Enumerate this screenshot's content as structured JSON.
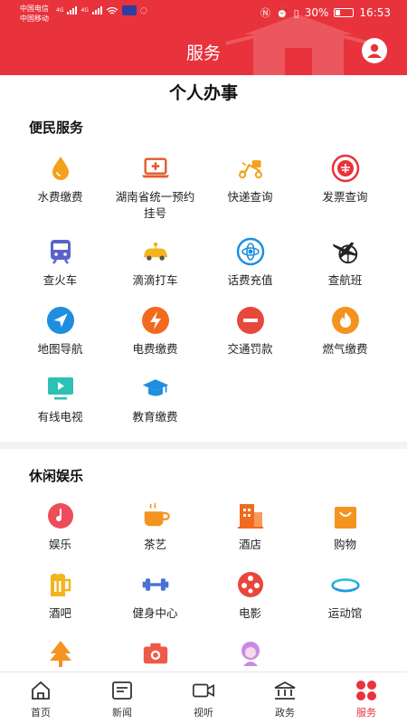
{
  "status_bar": {
    "carrier_1": "中国电信",
    "carrier_2": "中国移动",
    "net_1": "4G",
    "net_2": "4G",
    "battery": "30%",
    "time": "16:53"
  },
  "header": {
    "title": "服务"
  },
  "page_title": "个人办事",
  "sections": {
    "convenience": {
      "title": "便民服务",
      "items": [
        {
          "label": "水费缴费",
          "icon": "water-drop-icon"
        },
        {
          "label": "湖南省统一预约挂号",
          "icon": "medical-laptop-icon"
        },
        {
          "label": "快递查询",
          "icon": "delivery-scooter-icon"
        },
        {
          "label": "发票查询",
          "icon": "invoice-emblem-icon"
        },
        {
          "label": "查火车",
          "icon": "train-icon"
        },
        {
          "label": "滴滴打车",
          "icon": "taxi-icon"
        },
        {
          "label": "话费充值",
          "icon": "phone-recharge-icon"
        },
        {
          "label": "查航班",
          "icon": "airplane-icon"
        },
        {
          "label": "地图导航",
          "icon": "navigation-arrow-icon"
        },
        {
          "label": "电费缴费",
          "icon": "lightning-icon"
        },
        {
          "label": "交通罚款",
          "icon": "no-entry-icon"
        },
        {
          "label": "燃气缴费",
          "icon": "flame-icon"
        },
        {
          "label": "有线电视",
          "icon": "tv-play-icon"
        },
        {
          "label": "教育缴费",
          "icon": "graduation-cap-icon"
        }
      ]
    },
    "leisure": {
      "title": "休闲娱乐",
      "items": [
        {
          "label": "娱乐",
          "icon": "music-disc-icon"
        },
        {
          "label": "茶艺",
          "icon": "tea-cup-icon"
        },
        {
          "label": "酒店",
          "icon": "hotel-building-icon"
        },
        {
          "label": "购物",
          "icon": "shopping-bag-icon"
        },
        {
          "label": "酒吧",
          "icon": "beer-mug-icon"
        },
        {
          "label": "健身中心",
          "icon": "dumbbell-icon"
        },
        {
          "label": "电影",
          "icon": "film-reel-icon"
        },
        {
          "label": "运动馆",
          "icon": "stadium-icon"
        },
        {
          "label": "",
          "icon": "tree-icon"
        },
        {
          "label": "",
          "icon": "camera-icon"
        },
        {
          "label": "",
          "icon": "beauty-woman-icon"
        }
      ]
    }
  },
  "bottom_nav": [
    {
      "label": "首页",
      "icon": "home-icon",
      "active": false
    },
    {
      "label": "新闻",
      "icon": "news-icon",
      "active": false
    },
    {
      "label": "视听",
      "icon": "video-camera-icon",
      "active": false
    },
    {
      "label": "政务",
      "icon": "government-building-icon",
      "active": false
    },
    {
      "label": "服务",
      "icon": "services-dots-icon",
      "active": true
    }
  ],
  "colors": {
    "brand": "#e8323c",
    "orange": "#f4931f",
    "blue": "#1e8fe0"
  }
}
